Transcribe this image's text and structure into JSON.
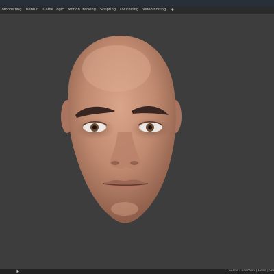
{
  "workspace_tabs": [
    "Compositing",
    "Default",
    "Game Logic",
    "Motion Tracking",
    "Scripting",
    "UV Editing",
    "Video Editing"
  ],
  "add_tab_label": "+",
  "status_bar": {
    "text": "Scene Collection | Head | Verts:63"
  },
  "icons": {
    "status": "cursor-icon"
  },
  "colors": {
    "viewport_bg": "#3d3d3d",
    "header_bg": "#2b2b2b",
    "skin": "#c48e74"
  }
}
